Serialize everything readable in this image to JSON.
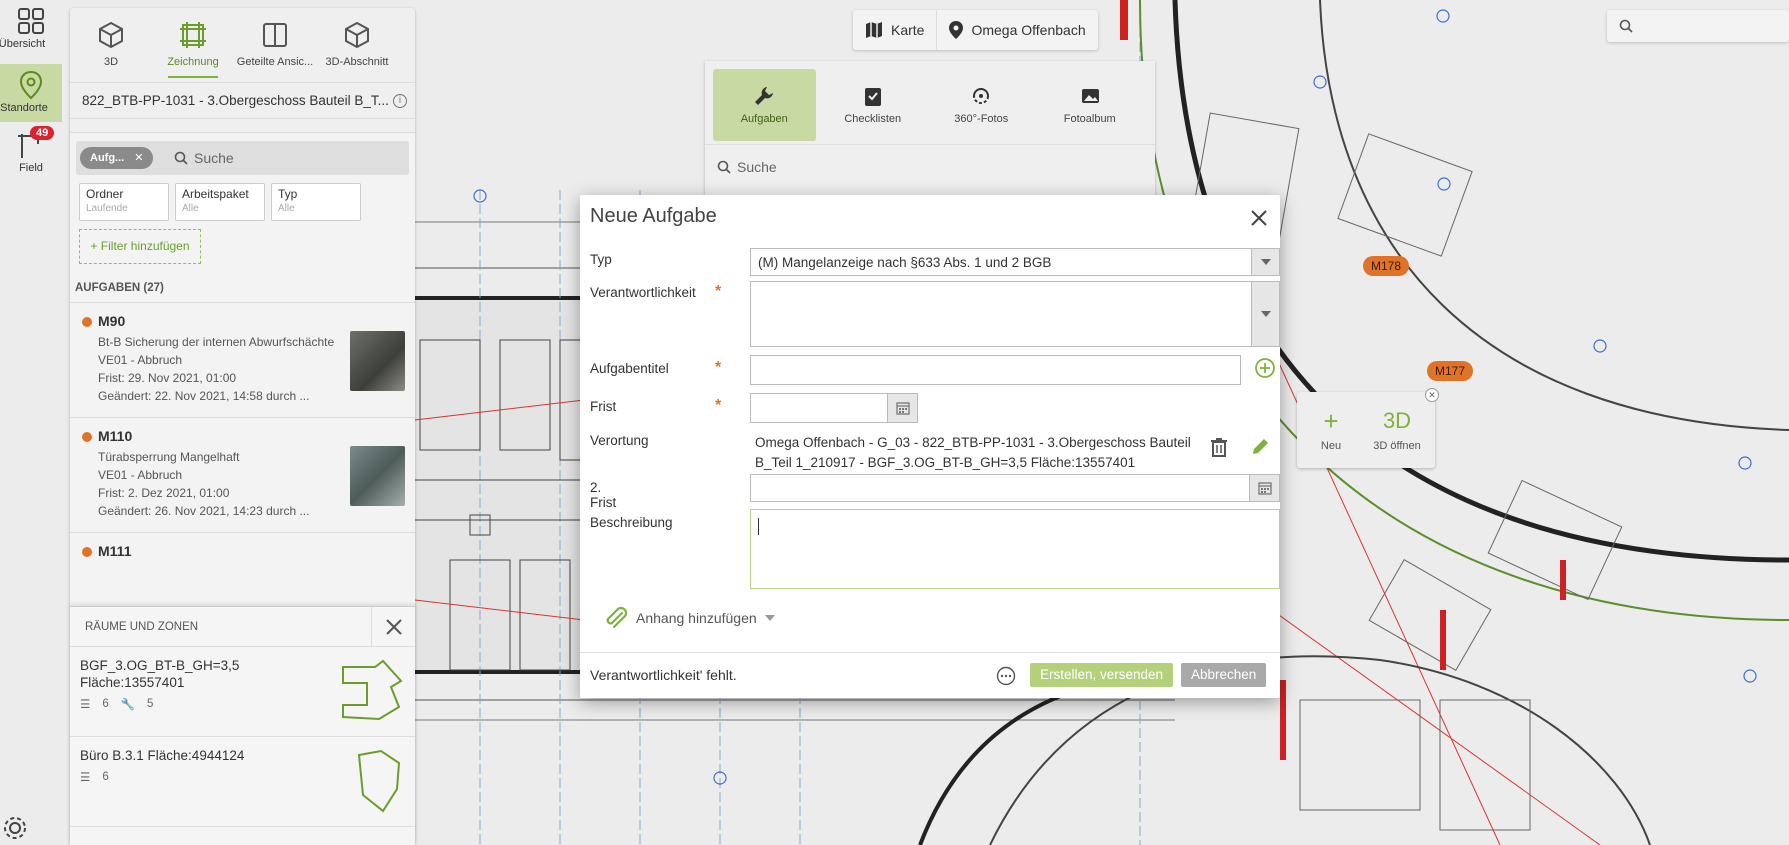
{
  "rail": {
    "items": [
      {
        "label": "Übersicht"
      },
      {
        "label": "Standorte"
      },
      {
        "label": "Field",
        "badge": "49"
      }
    ]
  },
  "panel": {
    "views": [
      {
        "label": "3D",
        "icon": "cube-icon"
      },
      {
        "label": "Zeichnung",
        "icon": "drawing-icon"
      },
      {
        "label": "Geteilte Ansic...",
        "icon": "split-view-icon"
      },
      {
        "label": "3D-Abschnitt",
        "icon": "cube-section-icon"
      }
    ],
    "drawing_title": "822_BTB-PP-1031 - 3.Obergeschoss Bauteil B_T...",
    "search": {
      "chip": "Aufg...",
      "placeholder": "Suche"
    },
    "filters": [
      {
        "label": "Ordner",
        "value": "Laufende"
      },
      {
        "label": "Arbeitspaket",
        "value": "Alle"
      },
      {
        "label": "Typ",
        "value": "Alle"
      }
    ],
    "add_filter": "+ Filter hinzufügen",
    "tasks_header": "AUFGABEN (27)",
    "tasks": [
      {
        "id": "M90",
        "desc": "Bt-B Sicherung der internen Abwurfschächte",
        "pkg": "VE01 - Abbruch",
        "due": "Frist: 29. Nov 2021, 01:00",
        "changed": "Geändert: 22. Nov 2021, 14:58 durch ..."
      },
      {
        "id": "M110",
        "desc": "Türabsperrung Mangelhaft",
        "pkg": "VE01 - Abbruch",
        "due": "Frist: 2. Dez 2021, 01:00",
        "changed": "Geändert: 26. Nov 2021, 14:23 durch ..."
      },
      {
        "id": "M111",
        "desc": "",
        "pkg": "",
        "due": "",
        "changed": ""
      }
    ]
  },
  "rooms": {
    "header": "RÄUME UND ZONEN",
    "items": [
      {
        "name": "BGF_3.OG_BT-B_GH=3,5 Fläche:13557401",
        "lists": "6",
        "tasks": "5"
      },
      {
        "name": "Büro B.3.1 Fläche:4944124",
        "lists": "6",
        "tasks": ""
      }
    ]
  },
  "mapbar": {
    "map_label": "Karte",
    "location_label": "Omega Offenbach"
  },
  "dock": {
    "tabs": [
      {
        "label": "Aufgaben",
        "icon": "wrench-icon"
      },
      {
        "label": "Checklisten",
        "icon": "checklist-icon"
      },
      {
        "label": "360°-Fotos",
        "icon": "panorama-icon"
      },
      {
        "label": "Fotoalbum",
        "icon": "photo-icon"
      }
    ],
    "search_placeholder": "Suche"
  },
  "markers": [
    {
      "label": "M178"
    },
    {
      "label": "M177"
    }
  ],
  "marker_popup": {
    "new_label": "Neu",
    "new_glyph": "+",
    "open3d_glyph": "3D",
    "open3d_label": "3D öffnen"
  },
  "dialog": {
    "title": "Neue Aufgabe",
    "fields": {
      "typ": {
        "label": "Typ",
        "value": "(M) Mangelanzeige nach §633 Abs. 1 und 2 BGB"
      },
      "verantwortlichkeit": {
        "label": "Verantwortlichkeit",
        "required": "*"
      },
      "aufgabentitel": {
        "label": "Aufgabentitel",
        "required": "*"
      },
      "frist": {
        "label": "Frist",
        "required": "*"
      },
      "verortung": {
        "label": "Verortung",
        "value": "Omega Offenbach - G_03 - 822_BTB-PP-1031 - 3.Obergeschoss Bauteil B_Teil 1_210917 - BGF_3.OG_BT-B_GH=3,5 Fläche:13557401"
      },
      "frist2": {
        "label": "2. Frist"
      },
      "beschreibung": {
        "label": "Beschreibung"
      }
    },
    "attach_label": "Anhang hinzufügen",
    "footer_message": "Verantwortlichkeit' fehlt.",
    "submit_label": "Erstellen, versenden",
    "cancel_label": "Abbrechen"
  },
  "colors": {
    "accent": "#7eb33b",
    "marker": "#e07328",
    "required": "#e8731e",
    "badge": "#d9232e"
  }
}
